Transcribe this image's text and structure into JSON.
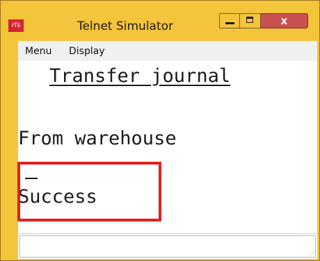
{
  "window": {
    "app_icon_text": "rfs",
    "title": "Telnet Simulator",
    "close_glyph": "x",
    "accent": "#f4c43a",
    "close_color": "#c75050"
  },
  "menu": {
    "items": [
      {
        "label": "Menu"
      },
      {
        "label": "Display"
      }
    ]
  },
  "screen": {
    "heading": "Transfer journal",
    "prompt_line": "From warehouse",
    "status_line": "Success",
    "highlight_color": "#e41f1f"
  },
  "input": {
    "value": ""
  }
}
